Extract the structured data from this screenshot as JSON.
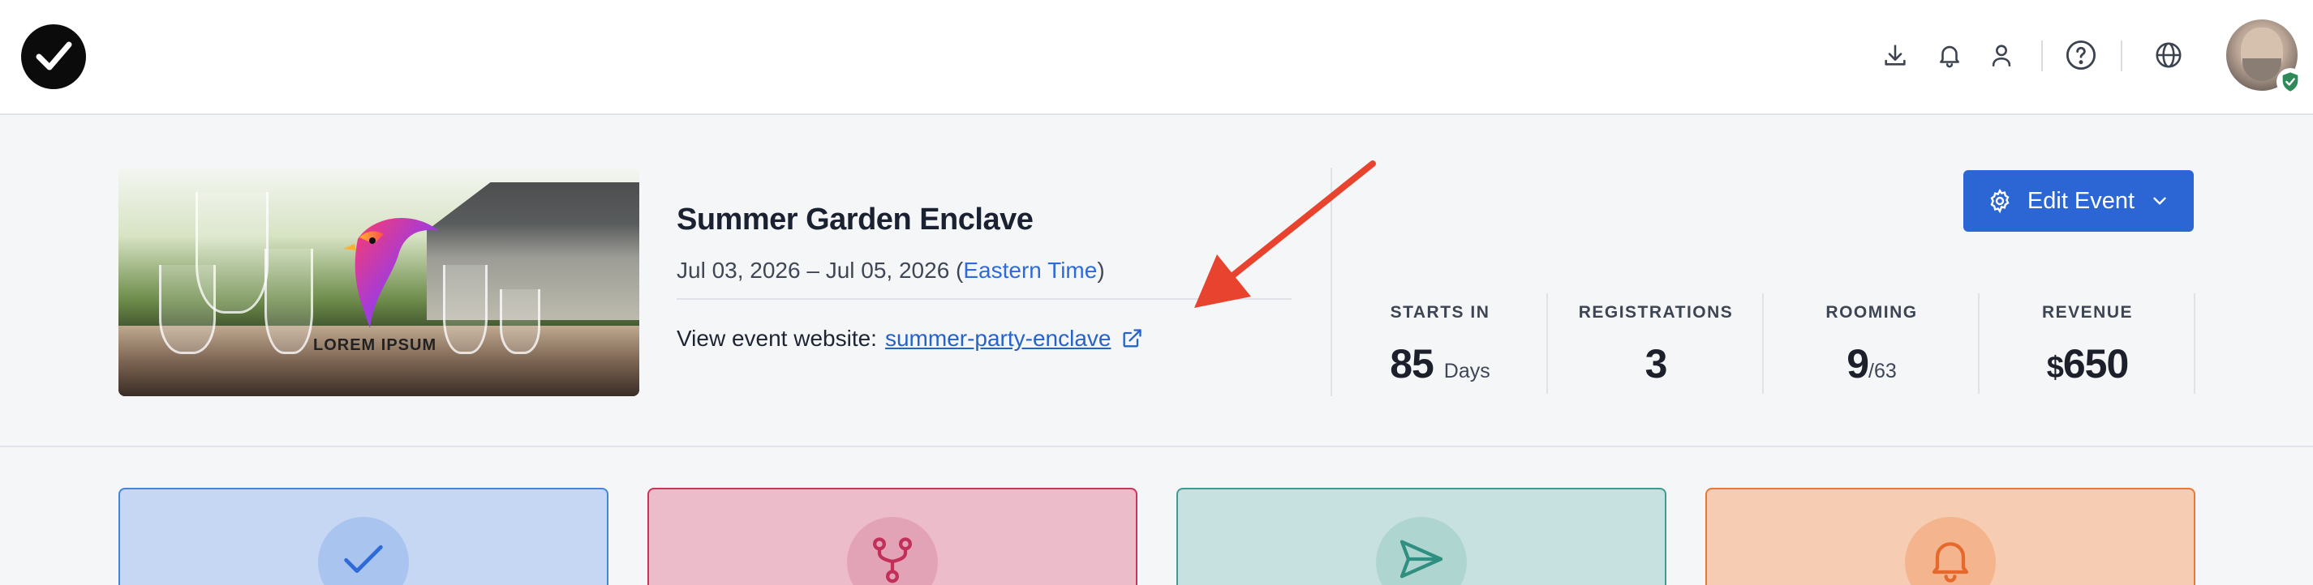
{
  "header": {
    "logo_icon": "checkmark-logo",
    "icons": [
      "download-icon",
      "bell-icon",
      "user-icon",
      "help-icon",
      "globe-icon"
    ],
    "avatar_badge_icon": "shield-check-icon"
  },
  "event": {
    "title": "Summer Garden Enclave",
    "dates_range": "Jul 03, 2026 – Jul 05, 2026 (",
    "timezone": "Eastern Time",
    "dates_close": ")",
    "website_label": "View event website:",
    "website_link": "summer-party-enclave",
    "image_text": "LOREM IPSUM"
  },
  "actions": {
    "edit_label": "Edit Event"
  },
  "stats": {
    "starts_in": {
      "label": "STARTS IN",
      "value": "85",
      "unit": "Days"
    },
    "registrations": {
      "label": "REGISTRATIONS",
      "value": "3"
    },
    "rooming": {
      "label": "ROOMING",
      "value": "9",
      "total": "/63"
    },
    "revenue": {
      "label": "REVENUE",
      "currency": "$",
      "value": "650"
    }
  },
  "cards": [
    {
      "icon": "check-icon",
      "bg": "#c5d7f3",
      "border": "#4a82db",
      "circle": "#a9c4ee",
      "icon_color": "#2f6bd8"
    },
    {
      "icon": "branch-icon",
      "bg": "#ecbccb",
      "border": "#c9345a",
      "circle": "#e3a3b7",
      "icon_color": "#c2305a"
    },
    {
      "icon": "send-icon",
      "bg": "#c6e1df",
      "border": "#3d9c8f",
      "circle": "#afd5d1",
      "icon_color": "#2f8f80"
    },
    {
      "icon": "bell-icon",
      "bg": "#f6cdb2",
      "border": "#e8773a",
      "circle": "#f3b48e",
      "icon_color": "#e5692c"
    }
  ],
  "colors": {
    "accent": "#2b66d4",
    "link": "#2563c9",
    "annotation_arrow": "#e8432f"
  }
}
